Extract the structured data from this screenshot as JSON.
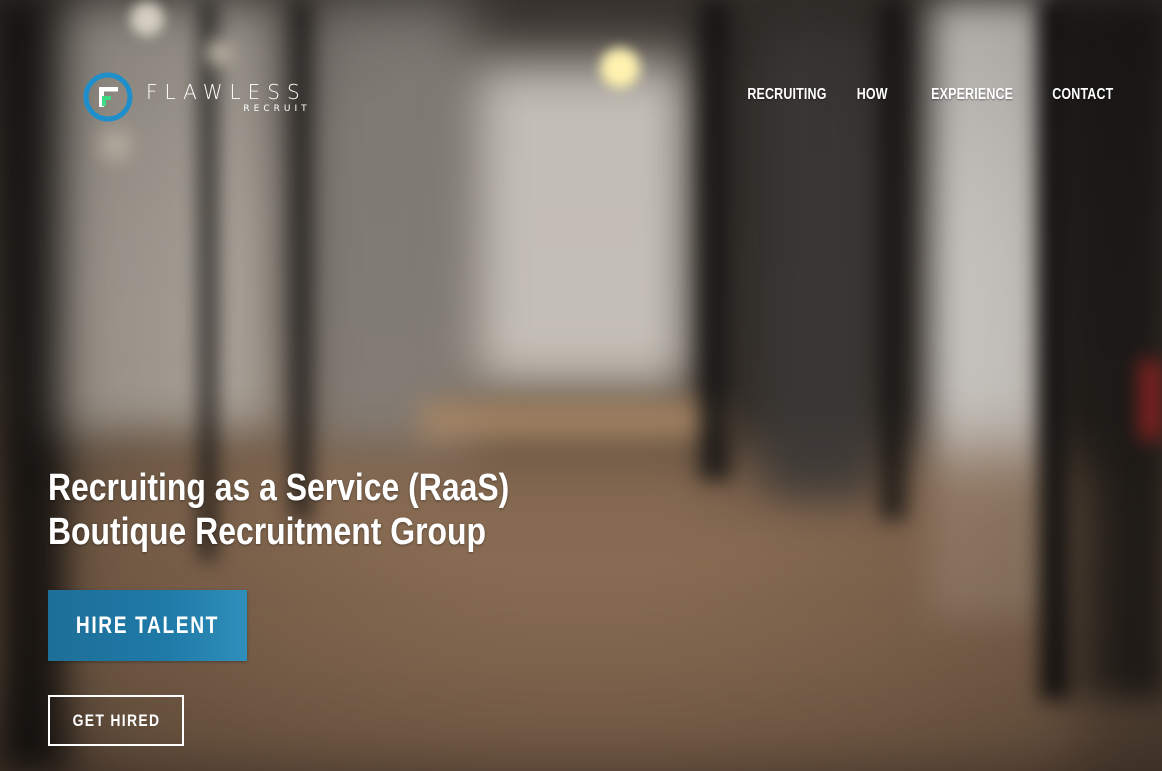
{
  "brand": {
    "name": "FLAWLESS",
    "tagline": "RECRUIT",
    "colors": {
      "ring": "#1e8fcb",
      "accent": "#3ddc84",
      "mark": "#ffffff"
    }
  },
  "nav": {
    "items": [
      {
        "label": "RECRUITING"
      },
      {
        "label": "HOW"
      },
      {
        "label": "EXPERIENCE"
      },
      {
        "label": "CONTACT"
      }
    ]
  },
  "hero": {
    "title_line1": "Recruiting as a Service (RaaS)",
    "title_line2": "Boutique Recruitment Group",
    "primary_cta": "HIRE TALENT",
    "secondary_cta": "GET HIRED",
    "colors": {
      "primary_button": "#1f7aa8",
      "text": "#ffffff"
    }
  }
}
